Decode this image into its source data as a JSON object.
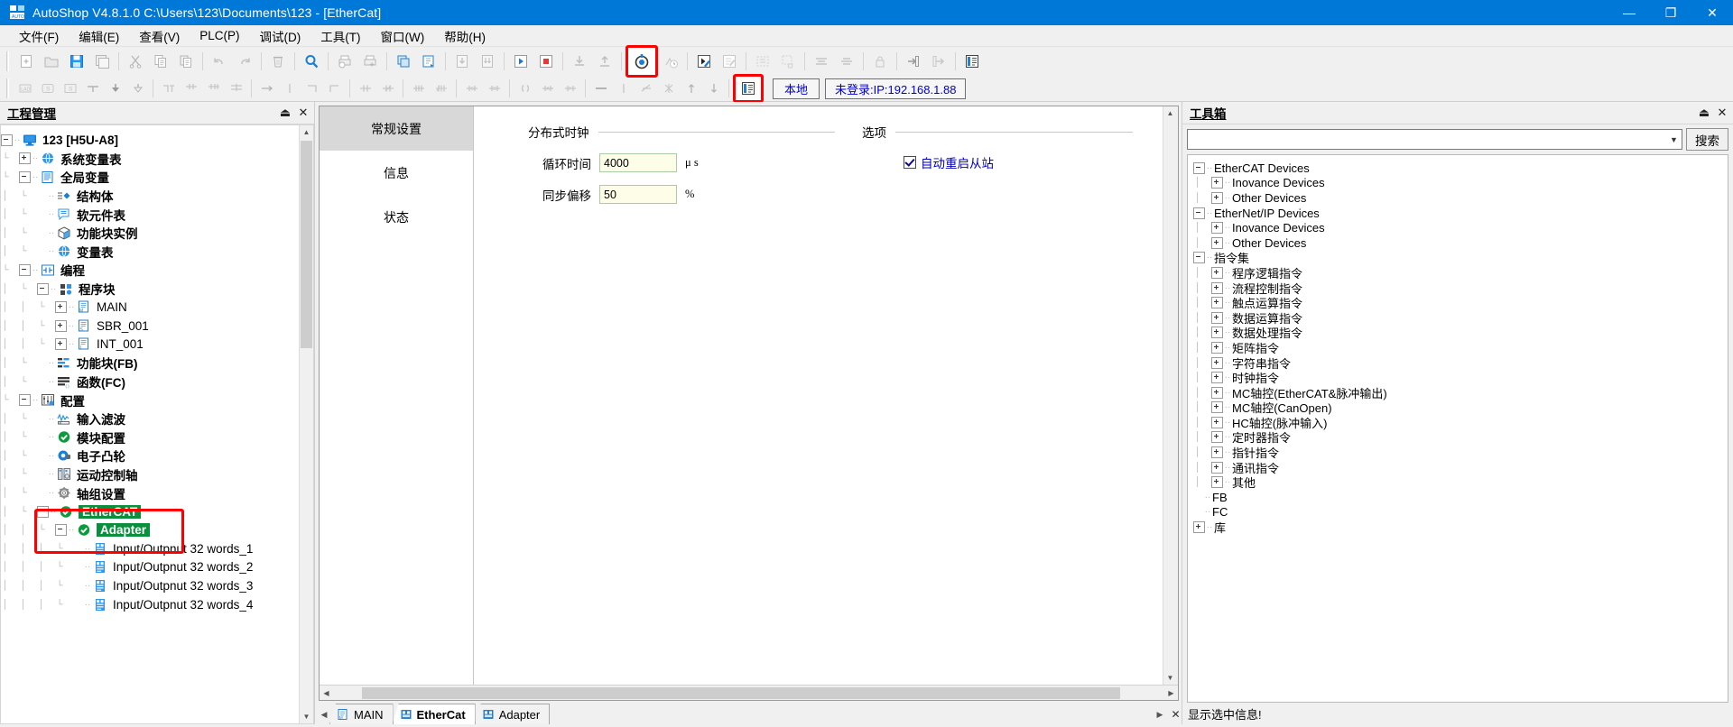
{
  "titlebar": {
    "title": "AutoShop V4.8.1.0  C:\\Users\\123\\Documents\\123 - [EtherCat]",
    "minimize": "—",
    "maximize": "❐",
    "close": "✕",
    "accent": "#0078d7"
  },
  "menubar": {
    "items": [
      {
        "label": "文件(F)"
      },
      {
        "label": "编辑(E)"
      },
      {
        "label": "查看(V)"
      },
      {
        "label": "PLC(P)"
      },
      {
        "label": "调试(D)"
      },
      {
        "label": "工具(T)"
      },
      {
        "label": "窗口(W)"
      },
      {
        "label": "帮助(H)"
      }
    ]
  },
  "toolbar1": {
    "icons": [
      "new-file-icon",
      "open-folder-icon",
      "save-icon",
      "save-all-icon",
      "cut-icon",
      "copy-icon",
      "paste-icon",
      "undo-icon",
      "redo-icon",
      "delete-icon",
      "search-icon",
      "print-preview-icon",
      "print-icon",
      "compile-icon",
      "compile-all-icon",
      "download-project-icon",
      "download-all-icon",
      "run-icon",
      "stop-icon",
      "download-to-plc-icon",
      "upload-from-plc-icon",
      "monitor-icon",
      "timing-monitor-icon",
      "debug-run-icon",
      "edit-mode-icon",
      "insert-network-icon",
      "delete-network-icon",
      "align-top-icon",
      "align-bottom-icon",
      "lock-icon",
      "login-icon",
      "logout-icon",
      "panel-icon"
    ],
    "highlighted_icon": "monitor-icon"
  },
  "toolbar2": {
    "icons": [
      "lad-icon",
      "st-icon",
      "sfc-icon",
      "contact-icon",
      "coil-down-icon",
      "coil-icon",
      "branch-icon",
      "contact-no-icon",
      "contact-nc-icon",
      "rung-icon",
      "line-right-icon",
      "line-up-icon",
      "line-corner-icon",
      "inst-1-icon",
      "inst-2-icon",
      "inst-3-icon",
      "inst-4-icon",
      "inst-5-icon",
      "inst-6-icon",
      "paren-icon",
      "bracket-a-icon",
      "bracket-f-icon",
      "hline-icon",
      "diag-icon",
      "cross-icon",
      "arrow-up-icon",
      "arrow-down-icon",
      "panel2-icon"
    ],
    "highlighted_icon": "panel2-icon",
    "local_button": "本地",
    "login_status": "未登录:IP:192.168.1.88"
  },
  "project_panel": {
    "title": "工程管理",
    "pin": "⏏",
    "close": "✕",
    "tree": [
      {
        "indent": 0,
        "expander": "minus",
        "icon": "computer-icon",
        "label": "123 [H5U-A8]",
        "bold": true
      },
      {
        "indent": 1,
        "expander": "plus",
        "icon": "globe-icon",
        "label": "系统变量表",
        "bold": true
      },
      {
        "indent": 1,
        "expander": "minus",
        "icon": "document-blue-icon",
        "label": "全局变量",
        "bold": true
      },
      {
        "indent": 2,
        "expander": "none",
        "icon": "struct-icon",
        "label": "结构体",
        "bold": true
      },
      {
        "indent": 2,
        "expander": "none",
        "icon": "softelement-icon",
        "label": "软元件表",
        "bold": true
      },
      {
        "indent": 2,
        "expander": "none",
        "icon": "cube-icon",
        "label": "功能块实例",
        "bold": true
      },
      {
        "indent": 2,
        "expander": "none",
        "icon": "globe-icon",
        "label": "变量表",
        "bold": true
      },
      {
        "indent": 1,
        "expander": "minus",
        "icon": "contact-icon",
        "label": "编程",
        "bold": true
      },
      {
        "indent": 2,
        "expander": "minus",
        "icon": "blocks-icon",
        "label": "程序块",
        "bold": true
      },
      {
        "indent": 3,
        "expander": "plus",
        "icon": "main-doc-icon",
        "label": "MAIN",
        "bold": false
      },
      {
        "indent": 3,
        "expander": "plus",
        "icon": "sbr-doc-icon",
        "label": "SBR_001",
        "bold": false
      },
      {
        "indent": 3,
        "expander": "plus",
        "icon": "int-doc-icon",
        "label": "INT_001",
        "bold": false
      },
      {
        "indent": 2,
        "expander": "none",
        "icon": "fb-icon",
        "label": "功能块(FB)",
        "bold": true
      },
      {
        "indent": 2,
        "expander": "none",
        "icon": "fc-icon",
        "label": "函数(FC)",
        "bold": true
      },
      {
        "indent": 1,
        "expander": "minus",
        "icon": "config-icon",
        "label": "配置",
        "bold": true
      },
      {
        "indent": 2,
        "expander": "none",
        "icon": "wave-icon",
        "label": "输入滤波",
        "bold": true
      },
      {
        "indent": 2,
        "expander": "none",
        "icon": "green-check-icon",
        "label": "模块配置",
        "bold": true
      },
      {
        "indent": 2,
        "expander": "none",
        "icon": "cam-icon",
        "label": "电子凸轮",
        "bold": true
      },
      {
        "indent": 2,
        "expander": "none",
        "icon": "motion-axis-icon",
        "label": "运动控制轴",
        "bold": true
      },
      {
        "indent": 2,
        "expander": "none",
        "icon": "gear-icon",
        "label": "轴组设置",
        "bold": true
      },
      {
        "indent": 2,
        "expander": "minus",
        "icon": "green-check-icon",
        "label": "EtherCAT",
        "bold": true,
        "selected": true
      },
      {
        "indent": 3,
        "expander": "minus",
        "icon": "green-check-icon",
        "label": "Adapter",
        "bold": true,
        "selected": true
      },
      {
        "indent": 4,
        "expander": "none",
        "icon": "io-module-icon",
        "label": "Input/Outpnut 32 words_1",
        "bold": false
      },
      {
        "indent": 4,
        "expander": "none",
        "icon": "io-module-icon",
        "label": "Input/Outpnut 32 words_2",
        "bold": false
      },
      {
        "indent": 4,
        "expander": "none",
        "icon": "io-module-icon",
        "label": "Input/Outpnut 32 words_3",
        "bold": false
      },
      {
        "indent": 4,
        "expander": "none",
        "icon": "io-module-icon",
        "label": "Input/Outpnut 32 words_4",
        "bold": false
      }
    ]
  },
  "editor": {
    "nav_items": [
      {
        "label": "常规设置",
        "active": true
      },
      {
        "label": "信息",
        "active": false
      },
      {
        "label": "状态",
        "active": false
      }
    ],
    "groups": [
      {
        "name": "distributed-clock",
        "title": "分布式时钟",
        "fields": [
          {
            "label": "循环时间",
            "value": "4000",
            "unit": "μ s"
          },
          {
            "label": "同步偏移",
            "value": "50",
            "unit": "%"
          }
        ]
      },
      {
        "name": "options",
        "title": "选项",
        "checkboxes": [
          {
            "label": "自动重启从站",
            "checked": true
          }
        ]
      }
    ],
    "tabs": [
      {
        "label": "MAIN",
        "icon": "main-tab-icon",
        "active": false
      },
      {
        "label": "EtherCat",
        "icon": "ethercat-tab-icon",
        "active": true
      },
      {
        "label": "Adapter",
        "icon": "adapter-tab-icon",
        "active": false
      }
    ],
    "tab_close": "✕",
    "tab_nav_left": "◀",
    "tab_nav_right": "▶"
  },
  "toolbox": {
    "title": "工具箱",
    "pin": "⏏",
    "close": "✕",
    "search_value": "",
    "search_button": "搜索",
    "status": "显示选中信息!",
    "tree": [
      {
        "indent": 0,
        "expander": "minus",
        "label": "EtherCAT Devices"
      },
      {
        "indent": 1,
        "expander": "plus",
        "label": "Inovance Devices"
      },
      {
        "indent": 1,
        "expander": "plus",
        "label": "Other Devices"
      },
      {
        "indent": 0,
        "expander": "minus",
        "label": "EtherNet/IP Devices"
      },
      {
        "indent": 1,
        "expander": "plus",
        "label": "Inovance Devices"
      },
      {
        "indent": 1,
        "expander": "plus",
        "label": "Other Devices"
      },
      {
        "indent": 0,
        "expander": "minus",
        "label": "指令集"
      },
      {
        "indent": 1,
        "expander": "plus",
        "label": "程序逻辑指令"
      },
      {
        "indent": 1,
        "expander": "plus",
        "label": "流程控制指令"
      },
      {
        "indent": 1,
        "expander": "plus",
        "label": "触点运算指令"
      },
      {
        "indent": 1,
        "expander": "plus",
        "label": "数据运算指令"
      },
      {
        "indent": 1,
        "expander": "plus",
        "label": "数据处理指令"
      },
      {
        "indent": 1,
        "expander": "plus",
        "label": "矩阵指令"
      },
      {
        "indent": 1,
        "expander": "plus",
        "label": "字符串指令"
      },
      {
        "indent": 1,
        "expander": "plus",
        "label": "时钟指令"
      },
      {
        "indent": 1,
        "expander": "plus",
        "label": "MC轴控(EtherCAT&脉冲输出)"
      },
      {
        "indent": 1,
        "expander": "plus",
        "label": "MC轴控(CanOpen)"
      },
      {
        "indent": 1,
        "expander": "plus",
        "label": "HC轴控(脉冲输入)"
      },
      {
        "indent": 1,
        "expander": "plus",
        "label": "定时器指令"
      },
      {
        "indent": 1,
        "expander": "plus",
        "label": "指针指令"
      },
      {
        "indent": 1,
        "expander": "plus",
        "label": "通讯指令"
      },
      {
        "indent": 1,
        "expander": "plus",
        "label": "其他"
      },
      {
        "indent": 0,
        "expander": "none",
        "label": "FB"
      },
      {
        "indent": 0,
        "expander": "none",
        "label": "FC"
      },
      {
        "indent": 0,
        "expander": "plus",
        "label": "库"
      }
    ]
  }
}
